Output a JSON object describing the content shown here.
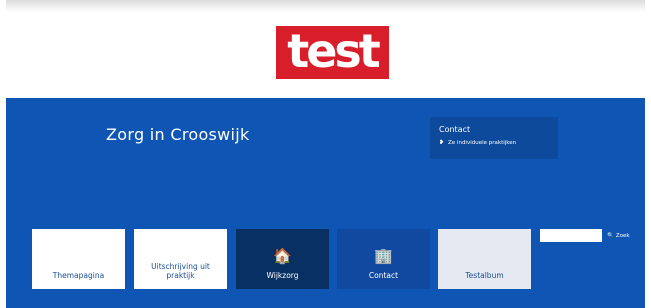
{
  "logo": {
    "text": "test"
  },
  "header": {
    "site_title": "Zorg in Crooswijk"
  },
  "contact_box": {
    "title": "Contact",
    "link_text": "Ze individuele praktijken",
    "link_icon": "map-pin-icon"
  },
  "tiles": [
    {
      "label": "Themapagina",
      "style": "white"
    },
    {
      "label": "Uitschrijving uit praktijk",
      "style": "white"
    },
    {
      "label": "Wijkzorg",
      "style": "dark",
      "icon": "home-icon",
      "glyph": "🏠"
    },
    {
      "label": "Contact",
      "style": "mid",
      "icon": "building-icon",
      "glyph": "🏢"
    },
    {
      "label": "Testalbum",
      "style": "light"
    }
  ],
  "search": {
    "placeholder": "",
    "button_label": "Zoek",
    "icon": "search-icon"
  },
  "colors": {
    "brand_red": "#d91e2b",
    "banner_blue": "#0f56b4",
    "tile_dark": "#083063"
  }
}
